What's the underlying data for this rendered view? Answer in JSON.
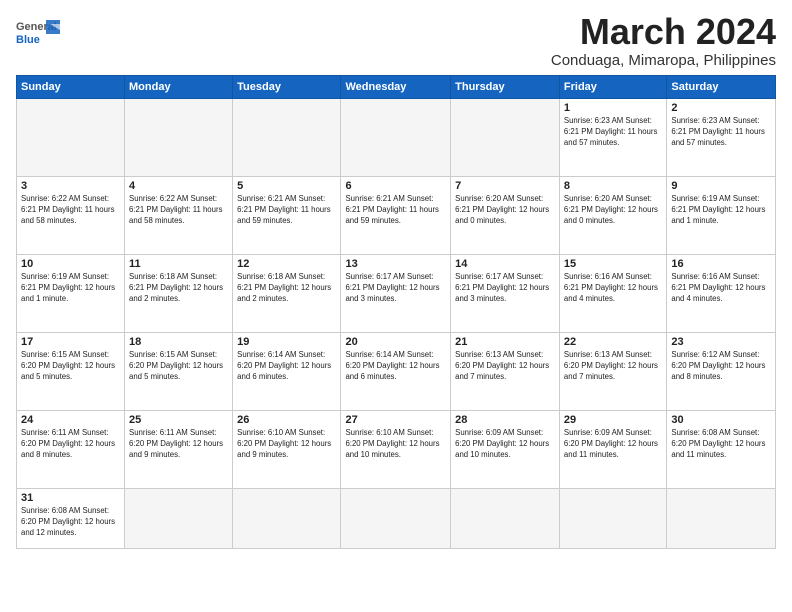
{
  "header": {
    "logo_general": "General",
    "logo_blue": "Blue",
    "month_title": "March 2024",
    "location": "Conduaga, Mimaropa, Philippines"
  },
  "weekdays": [
    "Sunday",
    "Monday",
    "Tuesday",
    "Wednesday",
    "Thursday",
    "Friday",
    "Saturday"
  ],
  "weeks": [
    [
      {
        "day": "",
        "info": ""
      },
      {
        "day": "",
        "info": ""
      },
      {
        "day": "",
        "info": ""
      },
      {
        "day": "",
        "info": ""
      },
      {
        "day": "",
        "info": ""
      },
      {
        "day": "1",
        "info": "Sunrise: 6:23 AM\nSunset: 6:21 PM\nDaylight: 11 hours\nand 57 minutes."
      },
      {
        "day": "2",
        "info": "Sunrise: 6:23 AM\nSunset: 6:21 PM\nDaylight: 11 hours\nand 57 minutes."
      }
    ],
    [
      {
        "day": "3",
        "info": "Sunrise: 6:22 AM\nSunset: 6:21 PM\nDaylight: 11 hours\nand 58 minutes."
      },
      {
        "day": "4",
        "info": "Sunrise: 6:22 AM\nSunset: 6:21 PM\nDaylight: 11 hours\nand 58 minutes."
      },
      {
        "day": "5",
        "info": "Sunrise: 6:21 AM\nSunset: 6:21 PM\nDaylight: 11 hours\nand 59 minutes."
      },
      {
        "day": "6",
        "info": "Sunrise: 6:21 AM\nSunset: 6:21 PM\nDaylight: 11 hours\nand 59 minutes."
      },
      {
        "day": "7",
        "info": "Sunrise: 6:20 AM\nSunset: 6:21 PM\nDaylight: 12 hours\nand 0 minutes."
      },
      {
        "day": "8",
        "info": "Sunrise: 6:20 AM\nSunset: 6:21 PM\nDaylight: 12 hours\nand 0 minutes."
      },
      {
        "day": "9",
        "info": "Sunrise: 6:19 AM\nSunset: 6:21 PM\nDaylight: 12 hours\nand 1 minute."
      }
    ],
    [
      {
        "day": "10",
        "info": "Sunrise: 6:19 AM\nSunset: 6:21 PM\nDaylight: 12 hours\nand 1 minute."
      },
      {
        "day": "11",
        "info": "Sunrise: 6:18 AM\nSunset: 6:21 PM\nDaylight: 12 hours\nand 2 minutes."
      },
      {
        "day": "12",
        "info": "Sunrise: 6:18 AM\nSunset: 6:21 PM\nDaylight: 12 hours\nand 2 minutes."
      },
      {
        "day": "13",
        "info": "Sunrise: 6:17 AM\nSunset: 6:21 PM\nDaylight: 12 hours\nand 3 minutes."
      },
      {
        "day": "14",
        "info": "Sunrise: 6:17 AM\nSunset: 6:21 PM\nDaylight: 12 hours\nand 3 minutes."
      },
      {
        "day": "15",
        "info": "Sunrise: 6:16 AM\nSunset: 6:21 PM\nDaylight: 12 hours\nand 4 minutes."
      },
      {
        "day": "16",
        "info": "Sunrise: 6:16 AM\nSunset: 6:21 PM\nDaylight: 12 hours\nand 4 minutes."
      }
    ],
    [
      {
        "day": "17",
        "info": "Sunrise: 6:15 AM\nSunset: 6:20 PM\nDaylight: 12 hours\nand 5 minutes."
      },
      {
        "day": "18",
        "info": "Sunrise: 6:15 AM\nSunset: 6:20 PM\nDaylight: 12 hours\nand 5 minutes."
      },
      {
        "day": "19",
        "info": "Sunrise: 6:14 AM\nSunset: 6:20 PM\nDaylight: 12 hours\nand 6 minutes."
      },
      {
        "day": "20",
        "info": "Sunrise: 6:14 AM\nSunset: 6:20 PM\nDaylight: 12 hours\nand 6 minutes."
      },
      {
        "day": "21",
        "info": "Sunrise: 6:13 AM\nSunset: 6:20 PM\nDaylight: 12 hours\nand 7 minutes."
      },
      {
        "day": "22",
        "info": "Sunrise: 6:13 AM\nSunset: 6:20 PM\nDaylight: 12 hours\nand 7 minutes."
      },
      {
        "day": "23",
        "info": "Sunrise: 6:12 AM\nSunset: 6:20 PM\nDaylight: 12 hours\nand 8 minutes."
      }
    ],
    [
      {
        "day": "24",
        "info": "Sunrise: 6:11 AM\nSunset: 6:20 PM\nDaylight: 12 hours\nand 8 minutes."
      },
      {
        "day": "25",
        "info": "Sunrise: 6:11 AM\nSunset: 6:20 PM\nDaylight: 12 hours\nand 9 minutes."
      },
      {
        "day": "26",
        "info": "Sunrise: 6:10 AM\nSunset: 6:20 PM\nDaylight: 12 hours\nand 9 minutes."
      },
      {
        "day": "27",
        "info": "Sunrise: 6:10 AM\nSunset: 6:20 PM\nDaylight: 12 hours\nand 10 minutes."
      },
      {
        "day": "28",
        "info": "Sunrise: 6:09 AM\nSunset: 6:20 PM\nDaylight: 12 hours\nand 10 minutes."
      },
      {
        "day": "29",
        "info": "Sunrise: 6:09 AM\nSunset: 6:20 PM\nDaylight: 12 hours\nand 11 minutes."
      },
      {
        "day": "30",
        "info": "Sunrise: 6:08 AM\nSunset: 6:20 PM\nDaylight: 12 hours\nand 11 minutes."
      }
    ],
    [
      {
        "day": "31",
        "info": "Sunrise: 6:08 AM\nSunset: 6:20 PM\nDaylight: 12 hours\nand 12 minutes."
      },
      {
        "day": "",
        "info": ""
      },
      {
        "day": "",
        "info": ""
      },
      {
        "day": "",
        "info": ""
      },
      {
        "day": "",
        "info": ""
      },
      {
        "day": "",
        "info": ""
      },
      {
        "day": "",
        "info": ""
      }
    ]
  ]
}
